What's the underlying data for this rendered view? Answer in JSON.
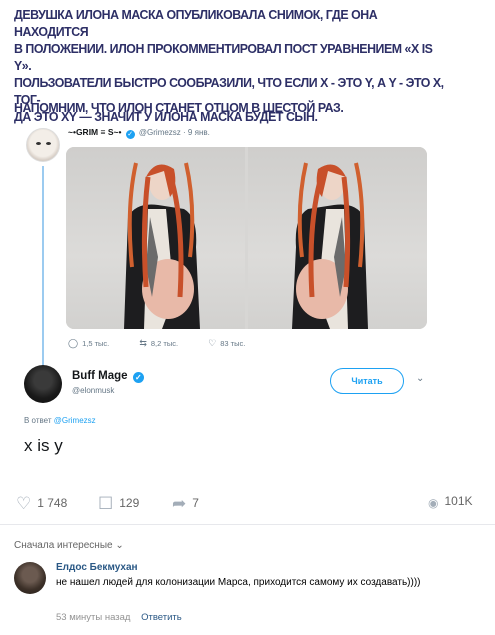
{
  "article": {
    "headline": "ДЕВУШКА ИЛОНА МАСКА ОПУБЛИКОВАЛА СНИМОК, ГДЕ ОНА НАХОДИТСЯ\nВ ПОЛОЖЕНИИ. ИЛОН ПРОКОММЕНТИРОВАЛ ПОСТ УРАВНЕНИЕМ «X IS Y».\nПОЛЬЗОВАТЕЛИ БЫСТРО СООБРАЗИЛИ, ЧТО ЕСЛИ X - ЭТО Y, А Y - ЭТО X, ТОГ-\nДА ЭТО XY — ЗНАЧИТ У ИЛОНА МАСКА БУДЕТ СЫН.",
    "subhead": "НАПОМНИМ, ЧТО ИЛОН СТАНЕТ ОТЦОМ В ШЕСТОЙ РАЗ."
  },
  "tweet_original": {
    "name": "~•GRIM ≡ S~•",
    "handle": "@Grimezsz",
    "date": "· 9 янв.",
    "replies": "1,5 тыс.",
    "retweets": "8,2 тыс.",
    "likes": "83 тыс."
  },
  "tweet_reply": {
    "name": "Buff Mage",
    "handle": "@elonmusk",
    "follow_label": "Читать",
    "reply_to_prefix": "В ответ",
    "reply_to_handle": "@Grimezsz",
    "text": "x is y"
  },
  "vk_post": {
    "likes": "1 748",
    "comments": "129",
    "shares": "7",
    "views": "101K"
  },
  "comments": {
    "sort_label": "Сначала интересные",
    "items": [
      {
        "author": "Елдос Бекмухан",
        "text": "не нашел людей для колонизации Марса, приходится самому их создавать))))",
        "time": "53 минуты назад",
        "reply_label": "Ответить"
      }
    ]
  },
  "colors": {
    "headline": "#2d2f66",
    "twitter_blue": "#1da1f2",
    "vk_link": "#2a5885"
  }
}
